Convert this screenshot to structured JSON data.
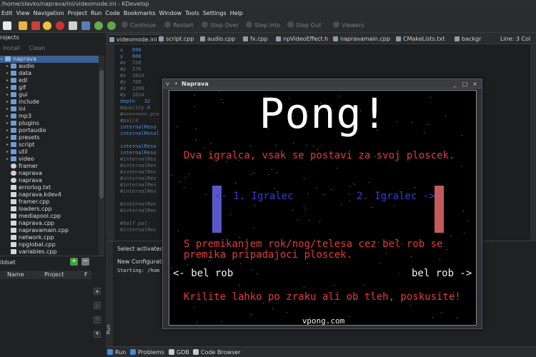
{
  "window": {
    "title": "/home/slavko/naprava/ini/videomode.ini - KDevelop"
  },
  "menu": [
    "Edit",
    "View",
    "Navigation",
    "Project",
    "Run",
    "Code",
    "Bookmarks",
    "Window",
    "Tools",
    "Settings",
    "Help"
  ],
  "toolbar": {
    "continue": "Continue",
    "restart": "Restart",
    "step_over": "Step Over",
    "step_into": "Step Into",
    "step_out": "Step Out",
    "viewers": "Viewers"
  },
  "projects": {
    "title": "rojects",
    "install": "Install",
    "clean": "Clean",
    "tree": [
      {
        "label": "naprava",
        "type": "root",
        "selected": true
      },
      {
        "label": "audio",
        "type": "folder"
      },
      {
        "label": "data",
        "type": "folder"
      },
      {
        "label": "edl",
        "type": "folder"
      },
      {
        "label": "gif",
        "type": "folder"
      },
      {
        "label": "gui",
        "type": "folder"
      },
      {
        "label": "include",
        "type": "folder"
      },
      {
        "label": "ini",
        "type": "folder"
      },
      {
        "label": "mp3",
        "type": "folder"
      },
      {
        "label": "plugins",
        "type": "folder"
      },
      {
        "label": "portaudio",
        "type": "folder"
      },
      {
        "label": "presets",
        "type": "folder"
      },
      {
        "label": "script",
        "type": "folder"
      },
      {
        "label": "util",
        "type": "folder"
      },
      {
        "label": "video",
        "type": "folder"
      },
      {
        "label": "framer",
        "type": "gear"
      },
      {
        "label": "naprava",
        "type": "gear"
      },
      {
        "label": "naprava",
        "type": "gear"
      },
      {
        "label": "errorlog.txt",
        "type": "file"
      },
      {
        "label": "naprava.kdev4",
        "type": "file"
      },
      {
        "label": "framer.cpp",
        "type": "cpp"
      },
      {
        "label": "loaders.cpp",
        "type": "cpp"
      },
      {
        "label": "mediapool.cpp",
        "type": "cpp"
      },
      {
        "label": "naprava.cpp",
        "type": "cpp"
      },
      {
        "label": "napravamain.cpp",
        "type": "cpp"
      },
      {
        "label": "network.cpp",
        "type": "cpp"
      },
      {
        "label": "npglobal.cpp",
        "type": "cpp"
      },
      {
        "label": "variables.cpp",
        "type": "cpp"
      }
    ]
  },
  "buildset": {
    "title": "ildset",
    "col_name": "Name",
    "col_project": "Project",
    "col_f": "F"
  },
  "tabs": [
    {
      "label": "videomode.ini",
      "active": true
    },
    {
      "label": "script.cpp"
    },
    {
      "label": "audio.cpp"
    },
    {
      "label": "fx.cpp"
    },
    {
      "label": "npVideoEffect.h"
    },
    {
      "label": "napravamain.cpp"
    },
    {
      "label": "CMakeLists.txt"
    },
    {
      "label": "backgr"
    }
  ],
  "linecol": "Line: 3 Col",
  "code_lines": [
    {
      "a": "x   ",
      "b": "800",
      "k": "num"
    },
    {
      "a": "y   ",
      "b": "600",
      "k": "num"
    },
    {
      "a": "#x  720",
      "b": "",
      "k": "com"
    },
    {
      "a": "#y  576",
      "b": "",
      "k": "com"
    },
    {
      "a": "#x  1024",
      "b": "",
      "k": "com"
    },
    {
      "a": "#y  768",
      "b": "",
      "k": "com"
    },
    {
      "a": "#x  1280",
      "b": "",
      "k": "com"
    },
    {
      "a": "#y  1024",
      "b": "",
      "k": "com"
    },
    {
      "a": "depth   ",
      "b": "32",
      "k": "num"
    },
    {
      "a": "#quality 0",
      "b": "",
      "k": "com"
    },
    {
      "a": "#======== pro",
      "b": "",
      "k": "com"
    },
    {
      "a": "#pal/4",
      "b": "",
      "k": "com"
    },
    {
      "a": "internalReso",
      "b": "",
      "k": "key"
    },
    {
      "a": "internalResol",
      "b": "",
      "k": "key"
    },
    {
      "a": "",
      "b": "",
      "k": "com"
    },
    {
      "a": "internalReso",
      "b": "",
      "k": "key"
    },
    {
      "a": "internalReso",
      "b": "",
      "k": "key"
    },
    {
      "a": "#internalRes",
      "b": "",
      "k": "com"
    },
    {
      "a": "#internalRes",
      "b": "",
      "k": "com"
    },
    {
      "a": "#internalRes",
      "b": "",
      "k": "com"
    },
    {
      "a": "#internalRes",
      "b": "",
      "k": "com"
    },
    {
      "a": "#internalRes",
      "b": "",
      "k": "com"
    },
    {
      "a": "#internalRes",
      "b": "",
      "k": "com"
    },
    {
      "a": "",
      "b": "",
      "k": "com"
    },
    {
      "a": "#internalRes",
      "b": "",
      "k": "com"
    },
    {
      "a": "#internalRes",
      "b": "",
      "k": "com"
    },
    {
      "a": "",
      "b": "",
      "k": "com"
    },
    {
      "a": "#half pal",
      "b": "",
      "k": "com"
    },
    {
      "a": "#internalRes",
      "b": "",
      "k": "com"
    }
  ],
  "bottom": {
    "select": "Select activated",
    "new_config": "New Configuratio",
    "starting": "Starting: /hom",
    "side": "Run"
  },
  "status": [
    "Run",
    "Problems",
    "GDB",
    "Code Browser"
  ],
  "dialog": {
    "title": "Naprava"
  },
  "game": {
    "title": "Pong!",
    "subtitle": "Dva igralca, vsak se postavi za svoj ploscek.",
    "player1": "<- 1. Igralec",
    "player2": "2. Igralec ->",
    "instr1": "S premikanjem rok/nog/telesa cez bel rob se",
    "instr2": "premika pripadajoci ploscek.",
    "left_edge": "<- bel rob",
    "right_edge": "bel rob ->",
    "wings": "Krilite lahko po zraku ali ob tleh, poskusite!",
    "footer": "vpong.com",
    "colors": {
      "red": "#e43b3b",
      "blue": "#3b3bd8",
      "paddle_left": "#5a58c8",
      "paddle_right": "#c45a5a"
    }
  }
}
